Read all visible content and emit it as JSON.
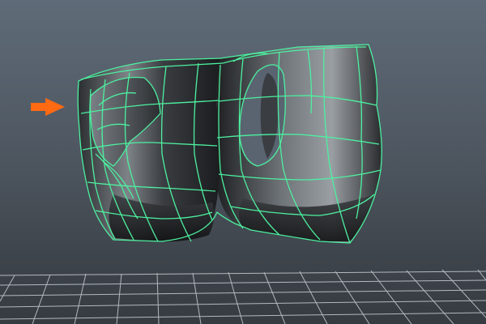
{
  "viewport": {
    "background_top": "#5f6b78",
    "background_bottom": "#363b41"
  },
  "colors": {
    "wireframe": "#4df0a0",
    "surface_light": "#8a8f94",
    "surface_dark": "#151719",
    "grid": "#c9ced3",
    "pointer_arrow": "#ff6a13"
  },
  "pointer": {
    "icon": "right-arrow-icon"
  },
  "grid": {
    "visible": true
  }
}
